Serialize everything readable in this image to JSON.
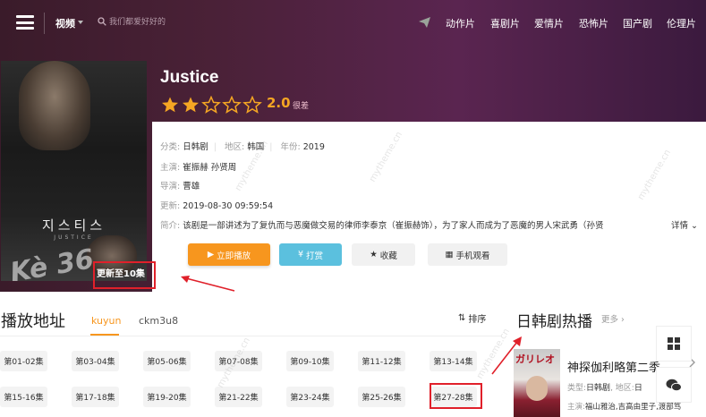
{
  "header": {
    "channel": "视频",
    "search_placeholder": "我们都爱好好的",
    "nav": [
      "动作片",
      "喜剧片",
      "爱情片",
      "恐怖片",
      "国产剧",
      "伦理片"
    ]
  },
  "poster": {
    "title": "지스티스",
    "subtitle": "JUSTICE",
    "watermark": "Kè 36",
    "badge": "更新至10集"
  },
  "movie": {
    "title": "Justice",
    "rating": {
      "stars_filled": 2,
      "stars_total": 5,
      "value": "2.0",
      "label": "很差"
    },
    "category_label": "分类:",
    "category": "日韩剧",
    "region_label": "地区:",
    "region": "韩国",
    "year_label": "年份:",
    "year": "2019",
    "cast_label": "主演:",
    "cast": "崔振赫 孙贤周",
    "director_label": "导演:",
    "director": "曹雄",
    "updated_label": "更新:",
    "updated": "2019-08-30 09:59:54",
    "desc_label": "简介:",
    "desc": "该剧是一部讲述为了复仇而与恶魔做交易的律师李泰京（崔振赫饰），为了家人而成为了恶魔的男人宋武勇（孙贤",
    "desc_more": "详情"
  },
  "actions": {
    "play": "立即播放",
    "tip": "打赏",
    "favorite": "收藏",
    "mobile": "手机观看"
  },
  "playlist": {
    "title": "播放地址",
    "sources": [
      "kuyun",
      "ckm3u8"
    ],
    "sort": "排序",
    "episodes_row1": [
      "第01-02集",
      "第03-04集",
      "第05-06集",
      "第07-08集",
      "第09-10集",
      "第11-12集",
      "第13-14集"
    ],
    "episodes_row2": [
      "第15-16集",
      "第17-18集",
      "第19-20集",
      "第21-22集",
      "第23-24集",
      "第25-26集",
      "第27-28集"
    ]
  },
  "hot": {
    "title": "日韩剧热播",
    "more": "更多",
    "thumb_text": "ガリレオ",
    "item_name": "神探伽利略第二季",
    "type_label": "类型:",
    "type": "日韩剧",
    "region_label": "地区:",
    "region": "日",
    "cast_label": "主演:",
    "cast": "福山雅治,吉高由里子,渡部笃"
  },
  "watermark": "mytheme.cn",
  "colors": {
    "accent": "#f7961e",
    "tip": "#5bc0de",
    "star": "#f5a623",
    "annotation": "#e0202a"
  }
}
